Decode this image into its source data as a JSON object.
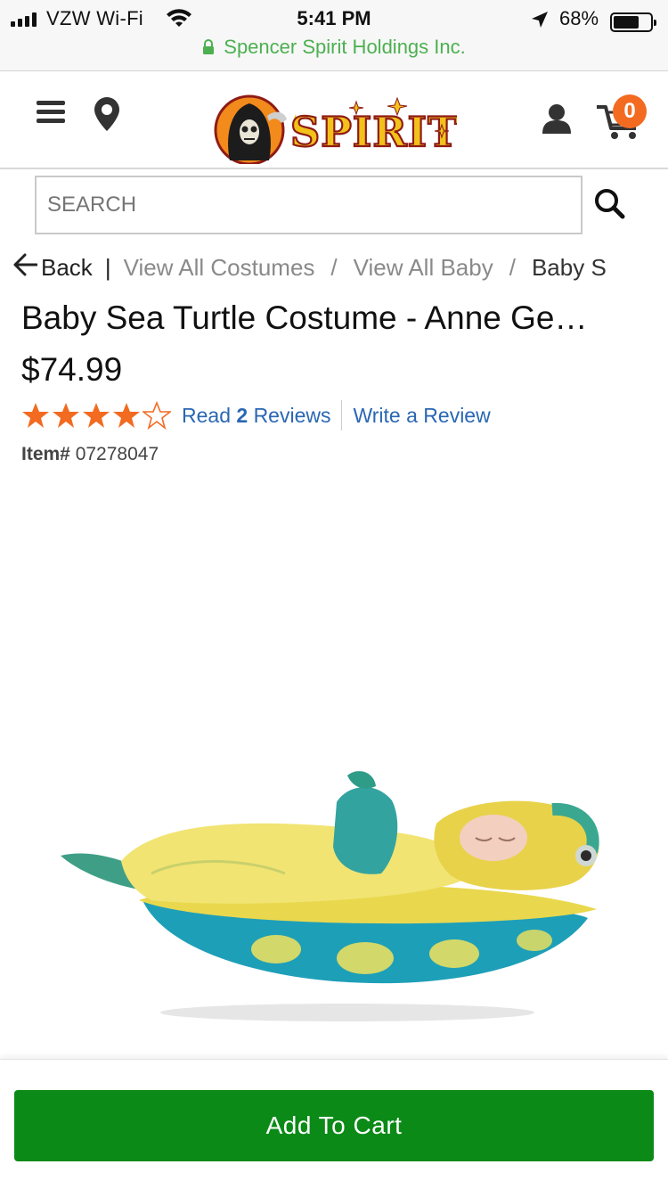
{
  "status_bar": {
    "carrier": "VZW Wi-Fi",
    "time": "5:41 PM",
    "battery": "68%",
    "url": "Spencer Spirit Holdings Inc."
  },
  "header": {
    "logo_text": "SPIRIT",
    "cart_count": "0"
  },
  "search": {
    "placeholder": "SEARCH"
  },
  "breadcrumb": {
    "back": "Back",
    "items": [
      "View All Costumes",
      "View All Baby",
      "Baby S"
    ]
  },
  "product": {
    "title": "Baby Sea Turtle Costume - Anne Ge…",
    "price": "$74.99",
    "rating": 4,
    "rating_max": 5,
    "read_prefix": "Read",
    "review_count": "2",
    "read_suffix": "Reviews",
    "write_review": "Write a Review",
    "item_label": "Item#",
    "item_number": "07278047"
  },
  "actions": {
    "add_to_cart": "Add To Cart"
  },
  "colors": {
    "star": "#f26b21",
    "link": "#2a67b3",
    "cta": "#0b8a17",
    "badge": "#f26b21",
    "secure": "#4cb050"
  }
}
